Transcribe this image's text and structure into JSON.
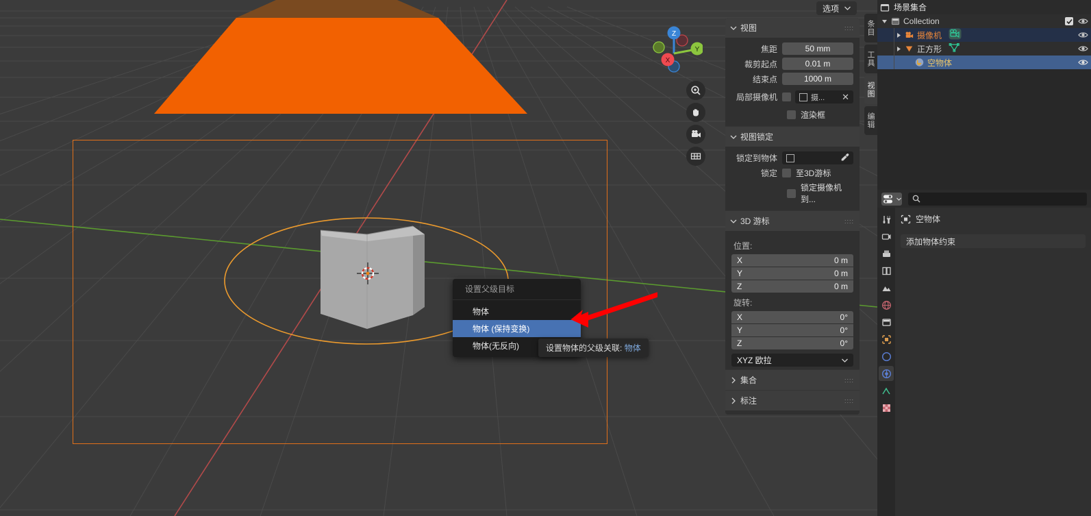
{
  "viewport": {
    "options_button": "选项",
    "vertical_tabs": [
      {
        "label": "条目",
        "active": false
      },
      {
        "label": "工具",
        "active": false
      },
      {
        "label": "视图",
        "active": true
      },
      {
        "label": "编辑",
        "active": false
      }
    ],
    "gizmo_axes": [
      "X",
      "Y",
      "Z"
    ],
    "nav_buttons": [
      "zoom-icon",
      "hand-icon",
      "camera-icon",
      "grid-icon"
    ]
  },
  "npanel": {
    "view": {
      "title": "视图",
      "focal_label": "焦距",
      "focal_value": "50 mm",
      "clip_start_label": "裁剪起点",
      "clip_start_value": "0.01 m",
      "clip_end_label": "结束点",
      "clip_end_value": "1000 m",
      "local_camera_label": "局部摄像机",
      "local_camera_value": "摄...",
      "render_region_label": "渲染框"
    },
    "view_lock": {
      "title": "视图锁定",
      "lock_to_object_label": "锁定到物体",
      "lock_label": "锁定",
      "lock_to_cursor": "至3D游标",
      "lock_camera": "锁定摄像机到..."
    },
    "cursor3d": {
      "title": "3D 游标",
      "location_label": "位置:",
      "location": [
        {
          "axis": "X",
          "value": "0 m"
        },
        {
          "axis": "Y",
          "value": "0 m"
        },
        {
          "axis": "Z",
          "value": "0 m"
        }
      ],
      "rotation_label": "旋转:",
      "rotation": [
        {
          "axis": "X",
          "value": "0°"
        },
        {
          "axis": "Y",
          "value": "0°"
        },
        {
          "axis": "Z",
          "value": "0°"
        }
      ],
      "rotation_mode": "XYZ 欧拉"
    },
    "collections": {
      "title": "集合"
    },
    "annotations": {
      "title": "标注"
    }
  },
  "context_menu": {
    "title": "设置父级目标",
    "items": [
      {
        "label": "物体",
        "selected": false
      },
      {
        "label": "物体 (保持变换)",
        "selected": true
      },
      {
        "label": "物体(无反向)",
        "selected": false
      }
    ]
  },
  "tooltip": {
    "text": "设置物体的父级关联:",
    "highlight": "物体"
  },
  "outliner": {
    "header_title": "场景集合",
    "rows": [
      {
        "name": "Collection",
        "indent": 1,
        "color": "white",
        "icon": "collection-icon",
        "expandable": true,
        "expanded": true,
        "checkbox": true,
        "state": "alt"
      },
      {
        "name": "摄像机",
        "indent": 2,
        "color": "orange",
        "icon": "camera-object-icon",
        "expandable": true,
        "expanded": false,
        "checkbox": false,
        "state": "sel-light"
      },
      {
        "name": "正方形",
        "indent": 2,
        "color": "white",
        "icon": "light-object-icon",
        "expandable": true,
        "expanded": false,
        "checkbox": false,
        "state": "alt"
      },
      {
        "name": "空物体",
        "indent": 3,
        "color": "yellow",
        "icon": "empty-object-icon",
        "expandable": false,
        "expanded": false,
        "checkbox": false,
        "state": "sel"
      }
    ]
  },
  "properties": {
    "search_placeholder": "",
    "breadcrumb_object": "空物体",
    "add_constraint_button": "添加物体约束",
    "tabs": [
      {
        "name": "tool-tab",
        "active": false
      },
      {
        "name": "render-tab",
        "active": false
      },
      {
        "name": "output-tab",
        "active": false
      },
      {
        "name": "view-layer-tab",
        "active": false
      },
      {
        "name": "scene-tab",
        "active": false
      },
      {
        "name": "world-tab",
        "active": false
      },
      {
        "name": "collection-tab",
        "active": false
      },
      {
        "name": "object-tab",
        "active": false
      },
      {
        "name": "modifier-tab",
        "active": false
      },
      {
        "name": "constraint-tab",
        "active": true
      },
      {
        "name": "object-data-tab",
        "active": false
      },
      {
        "name": "texture-tab",
        "active": false
      }
    ]
  },
  "colors": {
    "accent_orange": "#e2701a",
    "accent_blue": "#4772b3",
    "selection_blue": "#41608f",
    "plane_orange": "#f26101",
    "panel_bg": "#303030",
    "viewport_bg": "#3b3b3b"
  }
}
